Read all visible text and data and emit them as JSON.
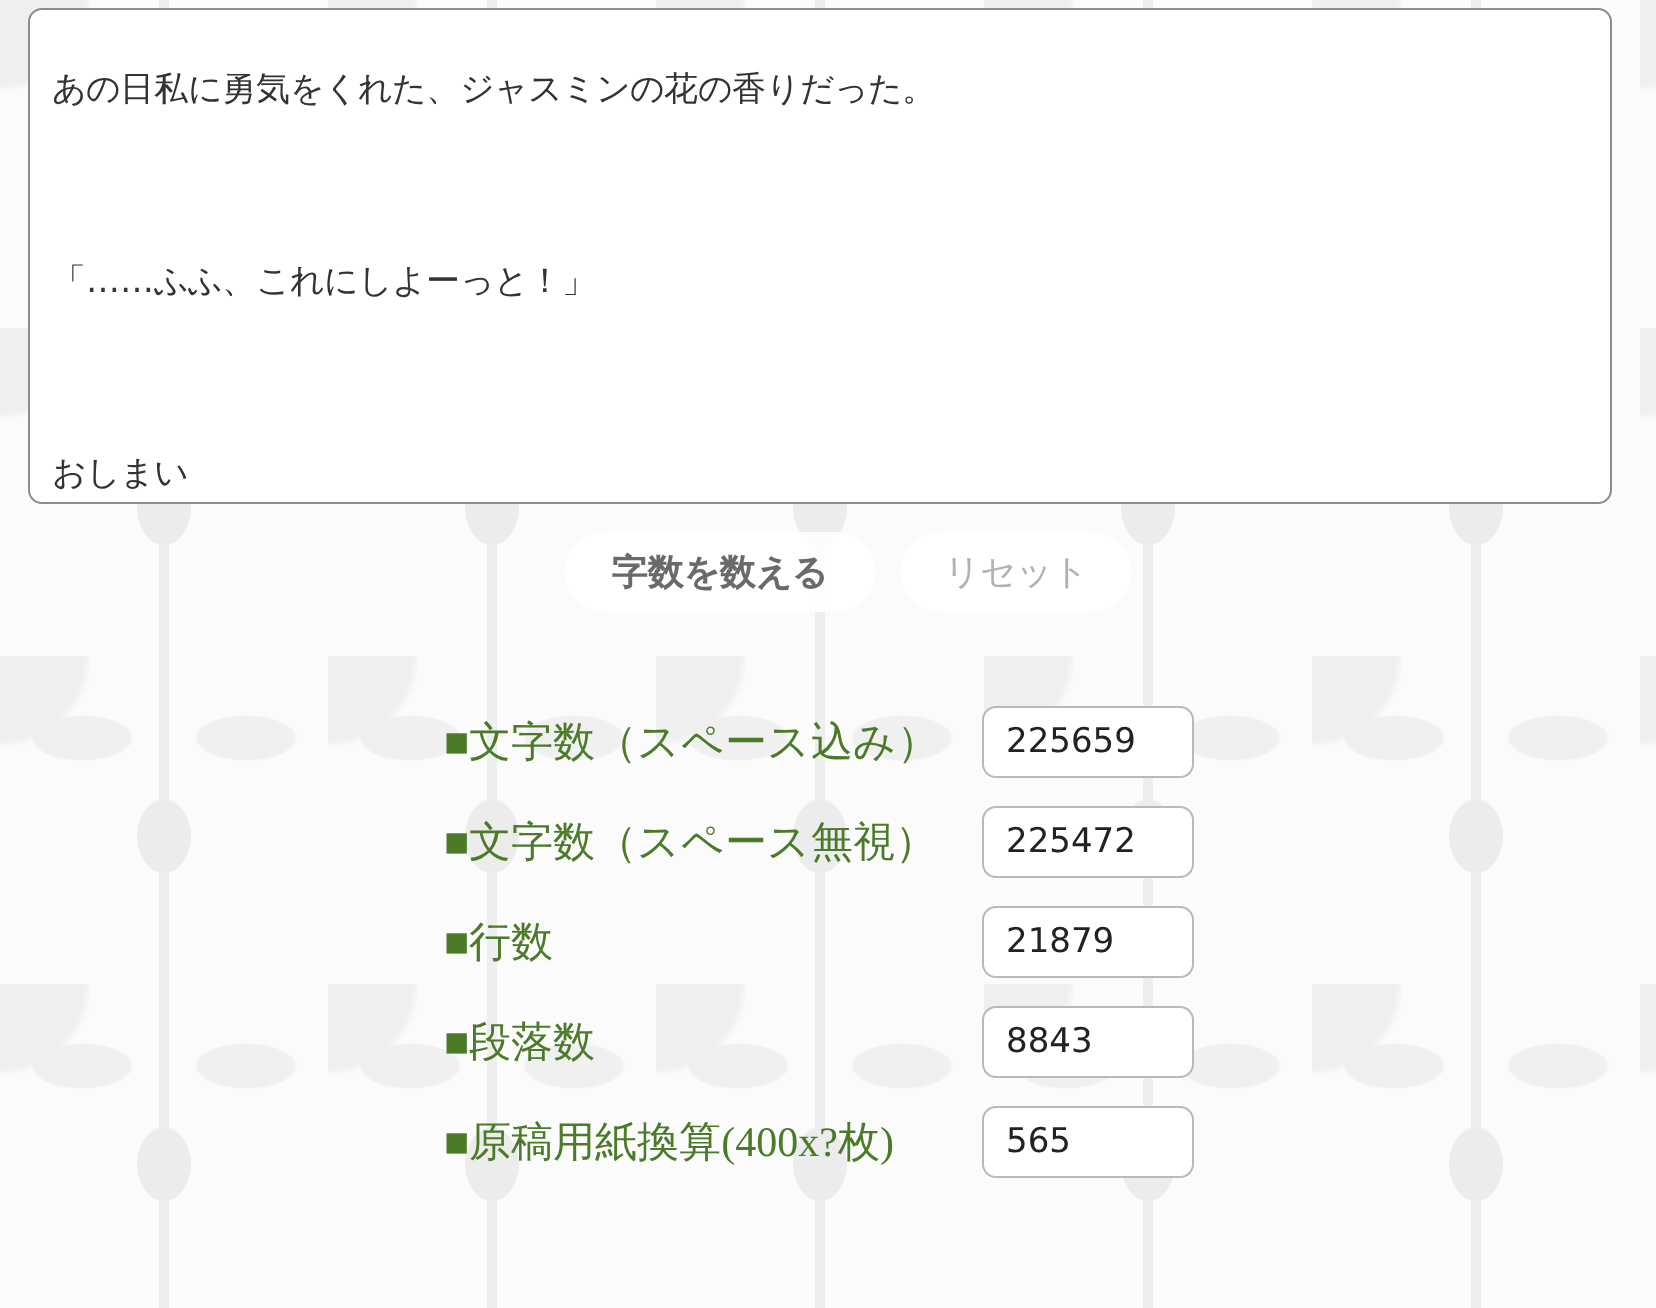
{
  "text_area": {
    "paragraphs": [
      "あの日私に勇気をくれた、ジャスミンの花の香りだった。",
      "「……ふふ、これにしよーっと！」",
      "おしまい"
    ]
  },
  "buttons": [
    {
      "label": "字数を数える",
      "disabled": false
    },
    {
      "label": "リセット",
      "disabled": true
    }
  ],
  "stats": [
    {
      "label": "■文字数（スペース込み）",
      "value": "225659"
    },
    {
      "label": "■文字数（スペース無視）",
      "value": "225472"
    },
    {
      "label": "■行数",
      "value": "21879"
    },
    {
      "label": "■段落数",
      "value": "8843"
    },
    {
      "label": "■原稿用紙換算(400x?枚)",
      "value": "565"
    }
  ]
}
